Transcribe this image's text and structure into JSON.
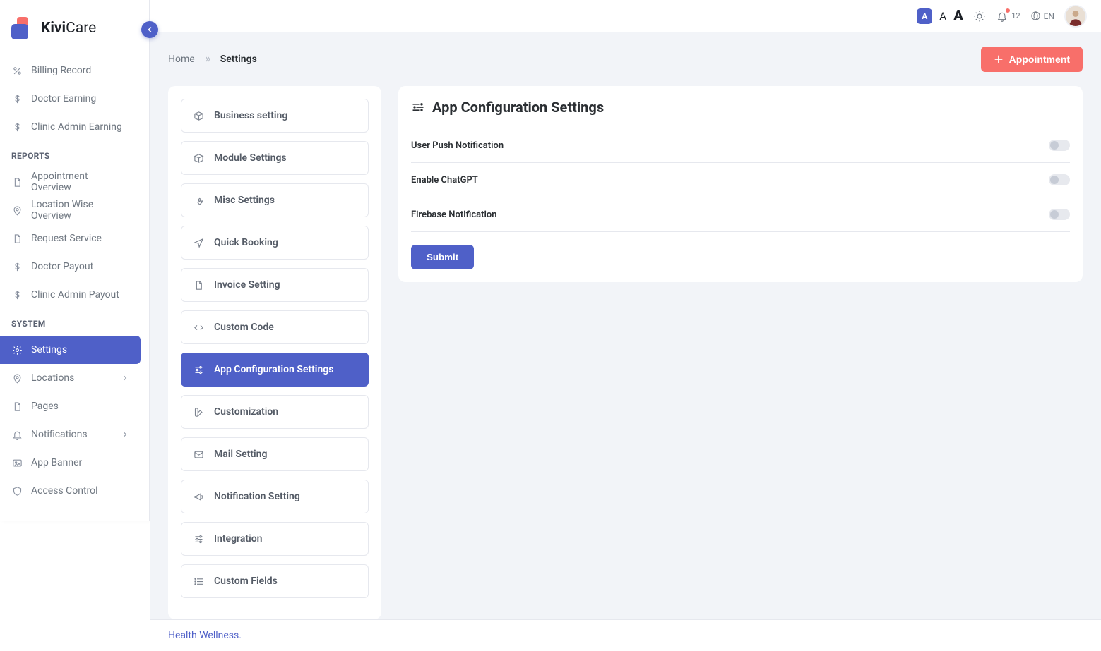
{
  "brand": {
    "name_a": "Kivi",
    "name_b": "Care"
  },
  "topbar": {
    "font_small": "A",
    "font_mid": "A",
    "font_big": "A",
    "notif_count": "12",
    "lang": "EN"
  },
  "breadcrumb": {
    "home": "Home",
    "current": "Settings"
  },
  "appointment_btn": "Appointment",
  "sidebar": {
    "loose_items": [
      {
        "icon": "percent",
        "label": "Billing Record"
      },
      {
        "icon": "dollar",
        "label": "Doctor Earning"
      },
      {
        "icon": "dollar",
        "label": "Clinic Admin Earning"
      }
    ],
    "reports_title": "REPORTS",
    "reports": [
      {
        "icon": "doc",
        "label": "Appointment Overview"
      },
      {
        "icon": "pin",
        "label": "Location Wise Overview"
      },
      {
        "icon": "doc",
        "label": "Request Service"
      },
      {
        "icon": "dollar",
        "label": "Doctor Payout"
      },
      {
        "icon": "dollar",
        "label": "Clinic Admin Payout"
      }
    ],
    "system_title": "SYSTEM",
    "system": [
      {
        "icon": "gear",
        "label": "Settings",
        "active": true
      },
      {
        "icon": "pin",
        "label": "Locations",
        "expand": true
      },
      {
        "icon": "doc",
        "label": "Pages"
      },
      {
        "icon": "bell",
        "label": "Notifications",
        "expand": true
      },
      {
        "icon": "image",
        "label": "App Banner"
      },
      {
        "icon": "shield",
        "label": "Access Control"
      }
    ]
  },
  "settings_tabs": [
    {
      "icon": "box",
      "label": "Business setting"
    },
    {
      "icon": "box",
      "label": "Module Settings"
    },
    {
      "icon": "wrench",
      "label": "Misc Settings"
    },
    {
      "icon": "send",
      "label": "Quick Booking"
    },
    {
      "icon": "doc",
      "label": "Invoice Setting"
    },
    {
      "icon": "code",
      "label": "Custom Code"
    },
    {
      "icon": "sliders",
      "label": "App Configuration Settings",
      "active": true
    },
    {
      "icon": "swatch",
      "label": "Customization"
    },
    {
      "icon": "mail",
      "label": "Mail Setting"
    },
    {
      "icon": "horn",
      "label": "Notification Setting"
    },
    {
      "icon": "sliders",
      "label": "Integration"
    },
    {
      "icon": "list",
      "label": "Custom Fields"
    }
  ],
  "panel": {
    "title": "App Configuration Settings",
    "rows": [
      {
        "label": "User Push Notification",
        "on": false
      },
      {
        "label": "Enable ChatGPT",
        "on": false
      },
      {
        "label": "Firebase Notification",
        "on": false
      }
    ],
    "submit": "Submit"
  },
  "footer": "Health Wellness."
}
